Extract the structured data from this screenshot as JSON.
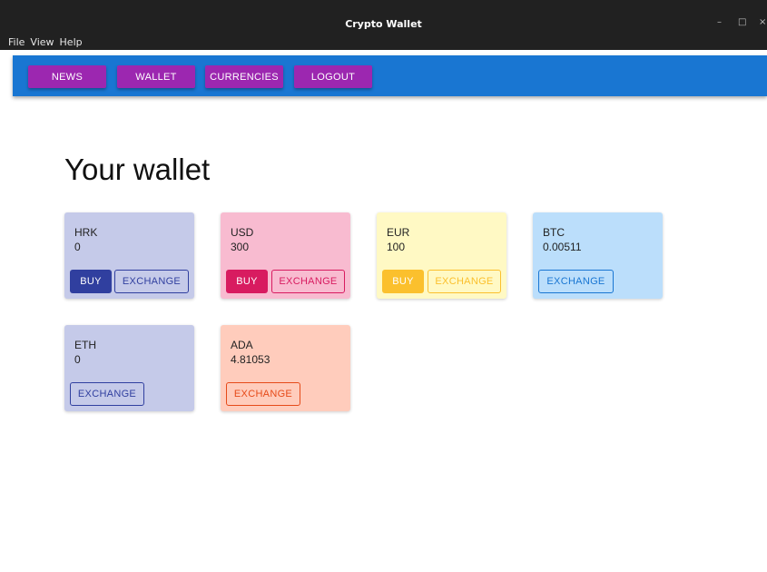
{
  "window": {
    "title": "Crypto Wallet",
    "controls": {
      "minimize": "–",
      "maximize": "□",
      "close": "×"
    },
    "menu": [
      "File",
      "View",
      "Help"
    ]
  },
  "navbar": {
    "buttons": [
      "NEWS",
      "WALLET",
      "CURRENCIES",
      "LOGOUT"
    ],
    "color": "#1976d2",
    "button_color": "#9c27b0"
  },
  "page_title": "Your wallet",
  "cards": [
    {
      "currency": "HRK",
      "amount": "0",
      "buy": "BUY",
      "exchange": "EXCHANGE",
      "bg": "#c5cae9",
      "accent": "#303f9f"
    },
    {
      "currency": "USD",
      "amount": "300",
      "buy": "BUY",
      "exchange": "EXCHANGE",
      "bg": "#f8bbd0",
      "accent": "#d81b60"
    },
    {
      "currency": "EUR",
      "amount": "100",
      "buy": "BUY",
      "exchange": "EXCHANGE",
      "bg": "#fff9c4",
      "accent": "#fbc02d"
    },
    {
      "currency": "BTC",
      "amount": "0.00511",
      "exchange": "EXCHANGE",
      "bg": "#bbdefb",
      "accent": "#1976d2"
    },
    {
      "currency": "ETH",
      "amount": "0",
      "exchange": "EXCHANGE",
      "bg": "#c5cae9",
      "accent": "#303f9f"
    },
    {
      "currency": "ADA",
      "amount": "4.81053",
      "exchange": "EXCHANGE",
      "bg": "#ffccbc",
      "accent": "#e64a19"
    }
  ]
}
